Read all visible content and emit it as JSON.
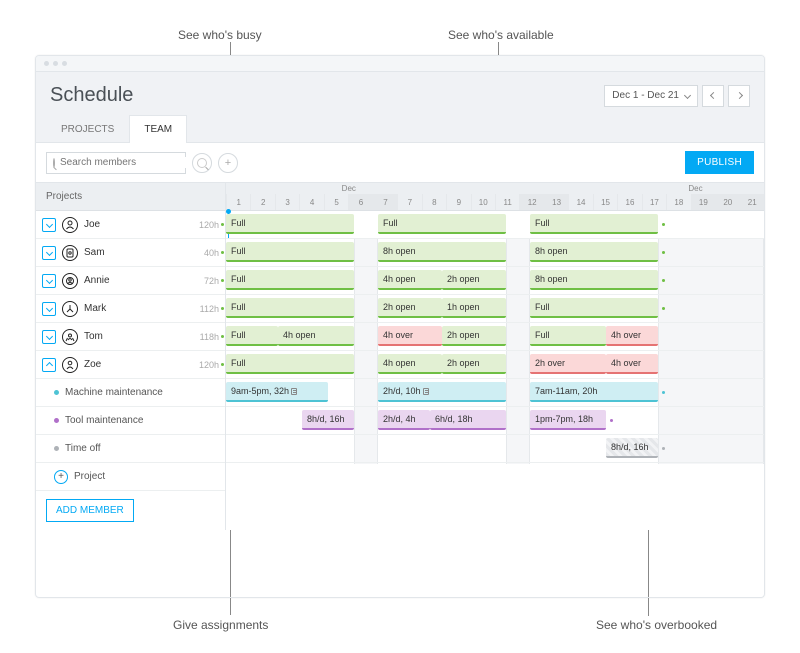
{
  "callouts": {
    "busy": "See who's busy",
    "available": "See who's available",
    "assignments": "Give assignments",
    "overbooked": "See who's overbooked"
  },
  "window_title": "Schedule",
  "date_range": "Dec 1 - Dec 21",
  "tabs": {
    "projects": "PROJECTS",
    "team": "TEAM"
  },
  "search_placeholder": "Search members",
  "publish_label": "PUBLISH",
  "grid_header": "Projects",
  "month_label": "Dec",
  "days": [
    "1",
    "2",
    "3",
    "4",
    "5",
    "6",
    "7",
    "7",
    "8",
    "9",
    "10",
    "11",
    "12",
    "13",
    "14",
    "15",
    "16",
    "17",
    "18",
    "19",
    "20",
    "21"
  ],
  "members": [
    {
      "name": "Joe",
      "hours": "120h"
    },
    {
      "name": "Sam",
      "hours": "40h"
    },
    {
      "name": "Annie",
      "hours": "72h"
    },
    {
      "name": "Mark",
      "hours": "112h"
    },
    {
      "name": "Tom",
      "hours": "118h"
    },
    {
      "name": "Zoe",
      "hours": "120h"
    }
  ],
  "tasks": {
    "machine": "Machine maintenance",
    "tool": "Tool maintenance",
    "timeoff": "Time off"
  },
  "add_project": "Project",
  "add_member": "ADD MEMBER",
  "labels": {
    "full": "Full",
    "8h_open": "8h open",
    "4h_open": "4h open",
    "2h_open": "2h open",
    "1h_open": "1h open",
    "4h_over": "4h over",
    "2h_over": "2h over",
    "teal_a": "9am-5pm, 32h",
    "teal_b": "2h/d, 10h",
    "teal_c": "7am-11am, 20h",
    "purple_a": "8h/d, 16h",
    "purple_b": "2h/d, 4h",
    "purple_c": "6h/d, 18h",
    "purple_d": "1pm-7pm, 18h",
    "grey_a": "8h/d, 16h"
  }
}
